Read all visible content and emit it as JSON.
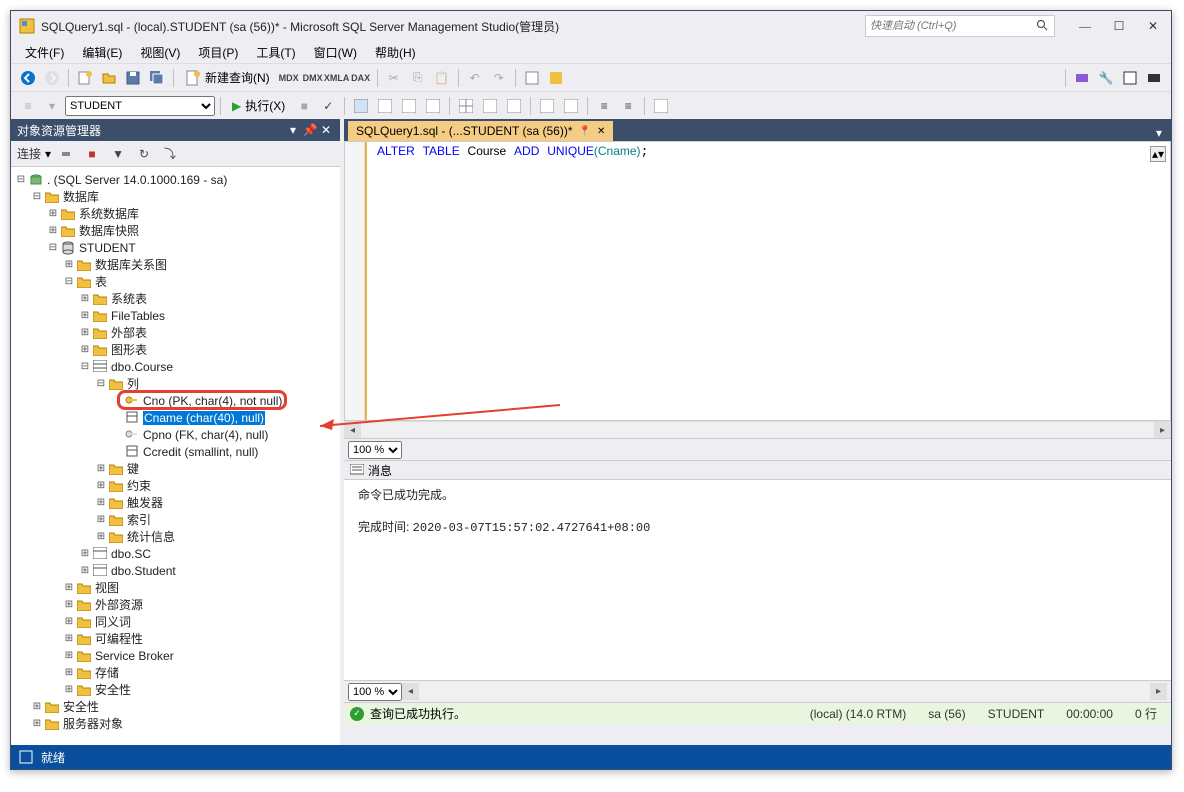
{
  "title": "SQLQuery1.sql - (local).STUDENT (sa (56))* - Microsoft SQL Server Management Studio(管理员)",
  "search_placeholder": "快速启动 (Ctrl+Q)",
  "menu": [
    "文件(F)",
    "编辑(E)",
    "视图(V)",
    "项目(P)",
    "工具(T)",
    "窗口(W)",
    "帮助(H)"
  ],
  "toolbar1": {
    "new_query": "新建查询(N)",
    "db_dropdown": "STUDENT"
  },
  "toolbar2": {
    "execute": "执行(X)"
  },
  "explorer": {
    "title": "对象资源管理器",
    "connect": "连接",
    "root": ". (SQL Server 14.0.1000.169 - sa)",
    "databases": "数据库",
    "sys_db": "系统数据库",
    "db_snapshot": "数据库快照",
    "student_db": "STUDENT",
    "db_diagrams": "数据库关系图",
    "tables": "表",
    "sys_tables": "系统表",
    "file_tables": "FileTables",
    "external_tables": "外部表",
    "graph_tables": "图形表",
    "dbo_course": "dbo.Course",
    "columns": "列",
    "col_cno": "Cno (PK, char(4), not null)",
    "col_cname": "Cname (char(40), null)",
    "col_cpno": "Cpno (FK, char(4), null)",
    "col_ccredit": "Ccredit (smallint, null)",
    "keys": "键",
    "constraints": "约束",
    "triggers": "触发器",
    "indexes": "索引",
    "statistics": "统计信息",
    "dbo_sc": "dbo.SC",
    "dbo_student": "dbo.Student",
    "views": "视图",
    "ext_resources": "外部资源",
    "synonyms": "同义词",
    "programmability": "可编程性",
    "service_broker": "Service Broker",
    "storage": "存储",
    "security_inner": "安全性",
    "security": "安全性",
    "server_objects": "服务器对象"
  },
  "tab": {
    "label": "SQLQuery1.sql - (...STUDENT (sa (56))*"
  },
  "sql": {
    "alter": "ALTER",
    "table": "TABLE",
    "course": "Course",
    "add": "ADD",
    "unique": "UNIQUE",
    "cname": "(Cname)"
  },
  "zoom": "100 %",
  "messages": {
    "tab": "消息",
    "done": "命令已成功完成。",
    "time_label": "完成时间: ",
    "time_value": "2020-03-07T15:57:02.4727641+08:00"
  },
  "exec_status": {
    "text": "查询已成功执行。",
    "server": "(local) (14.0 RTM)",
    "user": "sa (56)",
    "db": "STUDENT",
    "time": "00:00:00",
    "rows": "0 行"
  },
  "statusbar": {
    "ready": "就绪"
  }
}
